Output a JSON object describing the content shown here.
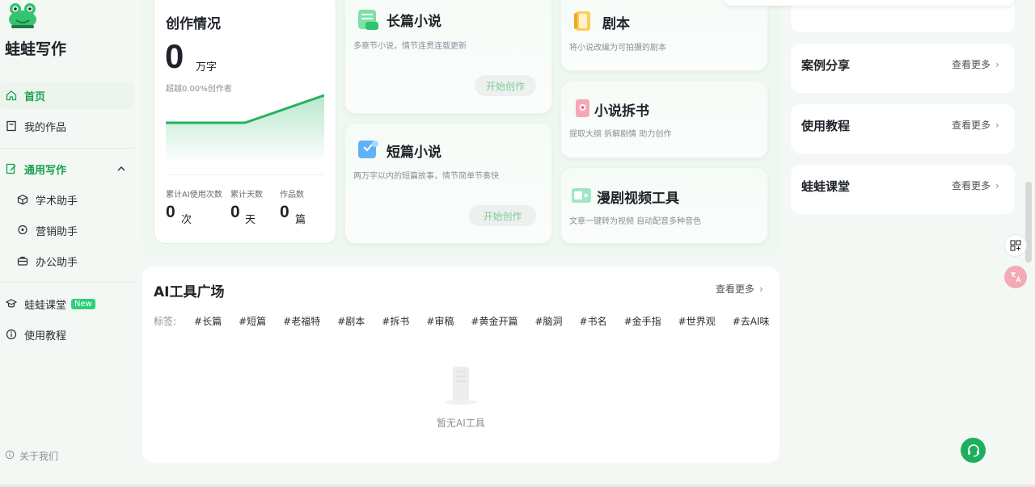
{
  "brand": {
    "name": "蛙蛙写作"
  },
  "sidebar": {
    "items": [
      {
        "label": "首页",
        "icon": "home-icon"
      },
      {
        "label": "我的作品",
        "icon": "book-icon"
      },
      {
        "label": "通用写作",
        "icon": "edit-icon"
      },
      {
        "label": "学术助手",
        "icon": "cube-icon"
      },
      {
        "label": "营销助手",
        "icon": "chat-icon"
      },
      {
        "label": "办公助手",
        "icon": "briefcase-icon"
      },
      {
        "label": "蛙蛙课堂",
        "icon": "graduation-cap-icon",
        "badge": "New"
      },
      {
        "label": "使用教程",
        "icon": "info-icon"
      }
    ],
    "about": "关于我们"
  },
  "stats": {
    "title": "创作情况",
    "words": "0",
    "words_unit": "万字",
    "exceed": "超越0.00%创作者",
    "items": [
      {
        "label": "累计AI使用次数",
        "value": "0",
        "unit": "次"
      },
      {
        "label": "累计天数",
        "value": "0",
        "unit": "天"
      },
      {
        "label": "作品数",
        "value": "0",
        "unit": "篇"
      }
    ]
  },
  "tools": {
    "long_novel": {
      "title": "长篇小说",
      "desc": "多章节小说，情节连贯连载更新",
      "button": "开始创作"
    },
    "short_novel": {
      "title": "短篇小说",
      "desc": "两万字以内的短篇故事，情节简单节奏快",
      "button": "开始创作"
    },
    "script": {
      "title": "剧本",
      "desc": "将小说改编为可拍摄的剧本"
    },
    "split": {
      "title": "小说拆书",
      "desc": "提取大纲 拆解剧情 助力创作"
    },
    "comic": {
      "title": "漫剧视频工具",
      "desc": "文章一键转为视频 自动配音多种音色"
    }
  },
  "ai_square": {
    "title": "AI工具广场",
    "more": "查看更多",
    "tag_label": "标签:",
    "tags": [
      "#长篇",
      "#短篇",
      "#老福特",
      "#剧本",
      "#拆书",
      "#审稿",
      "#黄金开篇",
      "#脑洞",
      "#书名",
      "#金手指",
      "#世界观",
      "#去AI味"
    ],
    "empty": "暂无AI工具"
  },
  "right": {
    "cards": [
      {
        "title": "案例分享",
        "more": "查看更多"
      },
      {
        "title": "使用教程",
        "more": "查看更多"
      },
      {
        "title": "蛙蛙课堂",
        "more": "查看更多"
      }
    ]
  },
  "colors": {
    "accent": "#1aa051",
    "chart_line": "#22b35e",
    "button_text": "#7ccc94"
  }
}
